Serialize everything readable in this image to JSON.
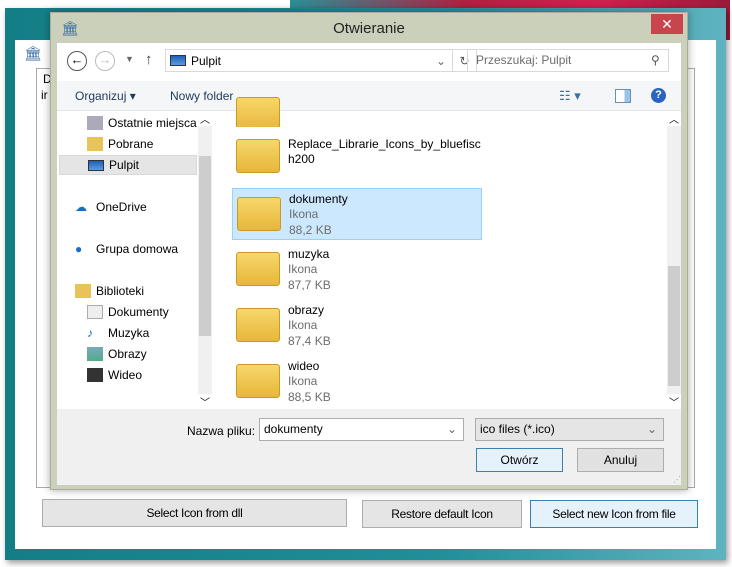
{
  "background_window": {
    "buttons": {
      "select_from_dll": "Select Icon from dll",
      "restore_default": "Restore default Icon",
      "select_from_file": "Select new Icon from file"
    },
    "group_label": "D",
    "field_prefix": "ir"
  },
  "dialog": {
    "title": "Otwieranie",
    "close_label": "✕",
    "address": "Pulpit",
    "search_placeholder": "Przeszukaj: Pulpit",
    "toolbar": {
      "organize": "Organizuj ▾",
      "new_folder": "Nowy folder"
    },
    "nav_items": [
      {
        "label": "Ostatnie miejsca",
        "icon": "recent-places-icon"
      },
      {
        "label": "Pobrane",
        "icon": "downloads-icon"
      },
      {
        "label": "Pulpit",
        "icon": "desktop-icon",
        "selected": true
      },
      {
        "label": "OneDrive",
        "icon": "onedrive-icon"
      },
      {
        "label": "Grupa domowa",
        "icon": "homegroup-icon"
      },
      {
        "label": "Biblioteki",
        "icon": "libraries-icon"
      },
      {
        "label": "Dokumenty",
        "icon": "documents-icon"
      },
      {
        "label": "Muzyka",
        "icon": "music-icon"
      },
      {
        "label": "Obrazy",
        "icon": "pictures-icon"
      },
      {
        "label": "Wideo",
        "icon": "video-icon"
      }
    ],
    "files": [
      {
        "name": "Replace_Librarie_Icons_by_bluefisc",
        "name2": "h200",
        "type": "",
        "size": ""
      },
      {
        "name": "dokumenty",
        "type": "Ikona",
        "size": "88,2 KB",
        "selected": true
      },
      {
        "name": "muzyka",
        "type": "Ikona",
        "size": "87,7 KB"
      },
      {
        "name": "obrazy",
        "type": "Ikona",
        "size": "87,4 KB"
      },
      {
        "name": "wideo",
        "type": "Ikona",
        "size": "88,5 KB"
      }
    ],
    "filename_label": "Nazwa pliku:",
    "filename_value": "dokumenty",
    "filter_value": "ico files (*.ico)",
    "open_label": "Otwórz",
    "cancel_label": "Anuluj"
  },
  "colors": {
    "selection": "#cce8ff",
    "close": "#c7454b",
    "frame": "#cbd0ba"
  }
}
